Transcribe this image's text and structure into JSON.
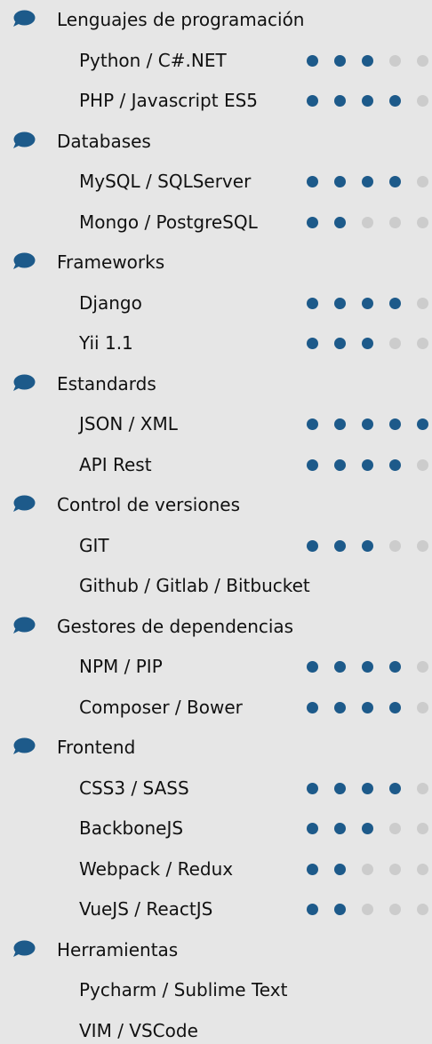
{
  "colors": {
    "accent": "#1d5a8a",
    "dot_off": "#cccccc",
    "background": "#e6e6e6"
  },
  "icon": "speech-bubble-icon",
  "scale_max": 5,
  "categories": [
    {
      "label": "Lenguajes de programación",
      "skills": [
        {
          "label": "Python / C#.NET",
          "level": 3
        },
        {
          "label": "PHP / Javascript ES5",
          "level": 4
        }
      ]
    },
    {
      "label": "Databases",
      "skills": [
        {
          "label": "MySQL / SQLServer",
          "level": 4
        },
        {
          "label": "Mongo / PostgreSQL",
          "level": 2
        }
      ]
    },
    {
      "label": "Frameworks",
      "skills": [
        {
          "label": "Django",
          "level": 4
        },
        {
          "label": "Yii 1.1",
          "level": 3
        }
      ]
    },
    {
      "label": "Estandards",
      "skills": [
        {
          "label": "JSON / XML",
          "level": 5
        },
        {
          "label": "API Rest",
          "level": 4
        }
      ]
    },
    {
      "label": "Control de versiones",
      "skills": [
        {
          "label": "GIT",
          "level": 3
        },
        {
          "label": "Github / Gitlab / Bitbucket",
          "level": null
        }
      ]
    },
    {
      "label": "Gestores de dependencias",
      "skills": [
        {
          "label": "NPM / PIP",
          "level": 4
        },
        {
          "label": "Composer / Bower",
          "level": 4
        }
      ]
    },
    {
      "label": "Frontend",
      "skills": [
        {
          "label": "CSS3 / SASS",
          "level": 4
        },
        {
          "label": "BackboneJS",
          "level": 3
        },
        {
          "label": "Webpack / Redux",
          "level": 2
        },
        {
          "label": "VueJS / ReactJS",
          "level": 2
        }
      ]
    },
    {
      "label": "Herramientas",
      "skills": [
        {
          "label": "Pycharm / Sublime Text",
          "level": null
        },
        {
          "label": "VIM / VSCode",
          "level": null
        }
      ]
    }
  ]
}
